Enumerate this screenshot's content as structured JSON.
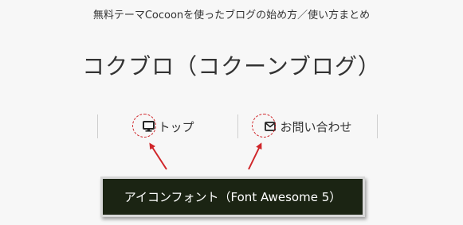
{
  "header": {
    "tagline": "無料テーマCocoonを使ったブログの始め方／使い方まとめ",
    "site_title": "コクブロ（コクーンブログ）"
  },
  "nav": {
    "items": [
      {
        "label": "トップ",
        "icon": "desktop-icon"
      },
      {
        "label": "お問い合わせ",
        "icon": "envelope-icon"
      }
    ]
  },
  "annotation": {
    "callout_text": "アイコンフォント（Font Awesome 5）",
    "highlight_color": "#d0262a",
    "callout_bg": "#1b2413"
  }
}
